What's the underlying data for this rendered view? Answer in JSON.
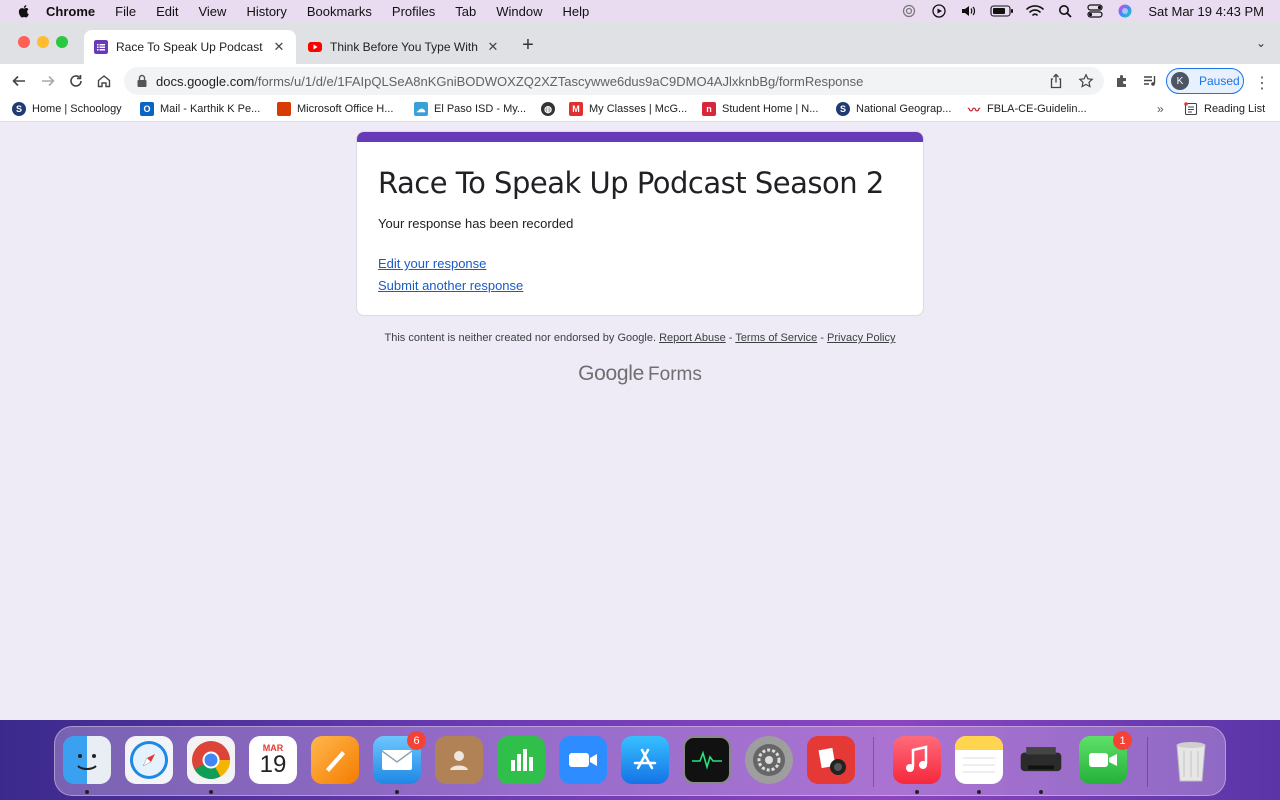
{
  "menubar": {
    "app_name": "Chrome",
    "items": [
      "File",
      "Edit",
      "View",
      "History",
      "Bookmarks",
      "Profiles",
      "Tab",
      "Window",
      "Help"
    ],
    "clock": "Sat Mar 19  4:43 PM"
  },
  "tabs": [
    {
      "title": "Race To Speak Up Podcast Sea",
      "favicon": "google-forms-icon",
      "active": true
    },
    {
      "title": "Think Before You Type With La",
      "favicon": "youtube-icon",
      "active": false
    }
  ],
  "address_bar": {
    "host": "docs.google.com",
    "path": "/forms/u/1/d/e/1FAIpQLSeA8nKGniBODWOXZQ2XZTascywwe6dus9aC9DMO4AJlxknbBg/formResponse"
  },
  "profile": {
    "initial": "K",
    "label": "Paused"
  },
  "bookmarks": [
    {
      "label": "Home | Schoology",
      "icon": "schoology-icon",
      "color": "#1f3b73"
    },
    {
      "label": "Mail - Karthik K Pe...",
      "icon": "outlook-icon",
      "color": "#0a64c2"
    },
    {
      "label": "Microsoft Office H...",
      "icon": "office-icon",
      "color": "#d83b01"
    },
    {
      "label": "El Paso ISD - My...",
      "icon": "cloud-icon",
      "color": "#3aa0d8"
    },
    {
      "label": "",
      "icon": "globe-icon",
      "color": "#333333"
    },
    {
      "label": "My Classes | McG...",
      "icon": "mcgraw-icon",
      "color": "#e03030"
    },
    {
      "label": "Student Home | N...",
      "icon": "n-icon",
      "color": "#d9263a"
    },
    {
      "label": "National Geograp...",
      "icon": "schoology-icon",
      "color": "#1f3b73"
    },
    {
      "label": "FBLA-CE-Guidelin...",
      "icon": "fbla-icon",
      "color": "#c81e2a"
    }
  ],
  "reading_list": "Reading List",
  "form": {
    "title": "Race To Speak Up Podcast Season 2",
    "message": "Your response has been recorded",
    "edit_link": "Edit your response",
    "submit_another_link": "Submit another response",
    "accent_color": "#673ab7"
  },
  "footer": {
    "text": "This content is neither created nor endorsed by Google.",
    "report_abuse": "Report Abuse",
    "terms": "Terms of Service",
    "privacy": "Privacy Policy",
    "separator": " - "
  },
  "branding": {
    "google": "Google",
    "forms": "Forms"
  },
  "dock": {
    "calendar_month": "MAR",
    "calendar_day": "19",
    "mail_badge": "6",
    "facetime_badge": "1"
  }
}
